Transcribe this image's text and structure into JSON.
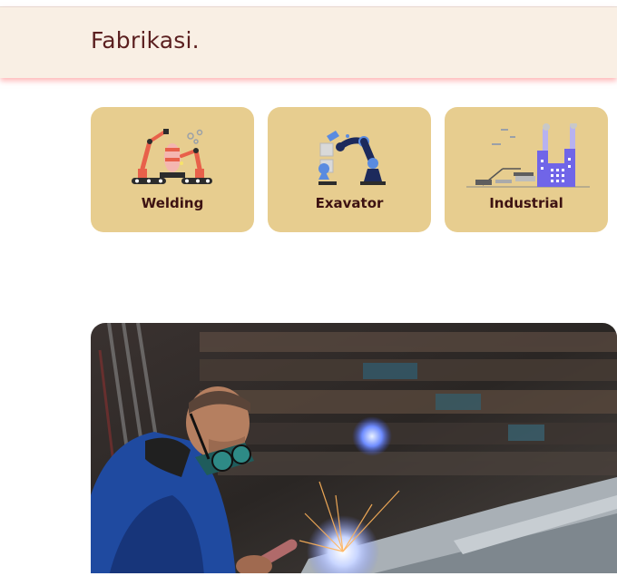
{
  "header": {
    "title": "Fabrikasi."
  },
  "categories": [
    {
      "label": "Welding",
      "icon": "welding-robots-icon"
    },
    {
      "label": "Exavator",
      "icon": "robotic-arm-icon"
    },
    {
      "label": "Industrial",
      "icon": "factory-icon"
    }
  ],
  "colors": {
    "header_bg": "#f9efe4",
    "card_bg": "#e7cd8f",
    "text_dark": "#3d1212"
  }
}
